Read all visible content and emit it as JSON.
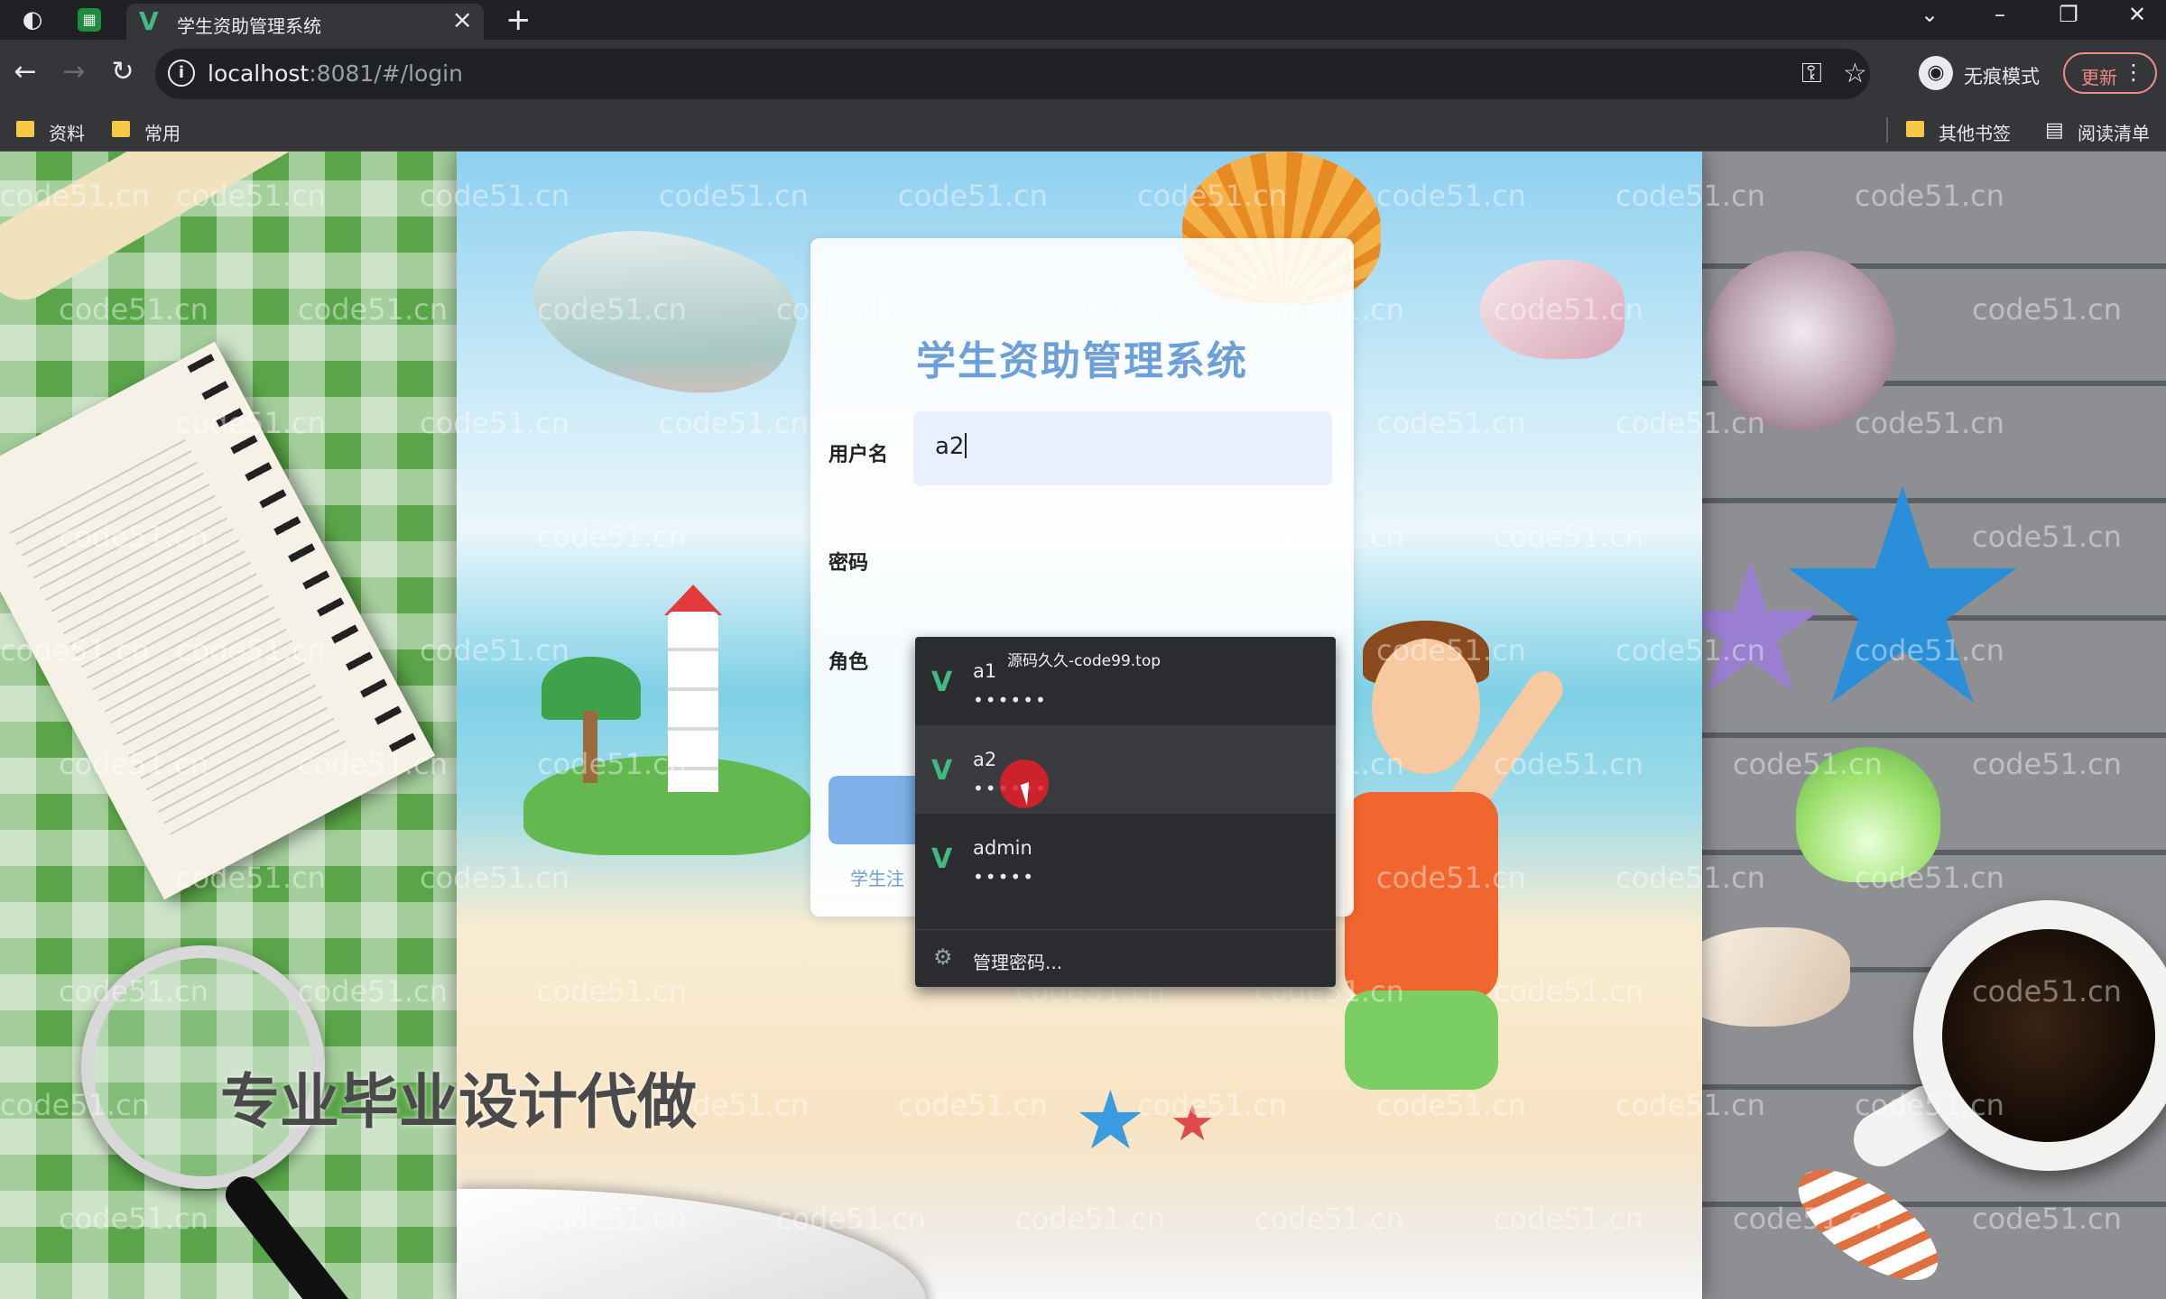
{
  "browser": {
    "tab_title": "学生资助管理系统",
    "url_host": "localhost",
    "url_rest": ":8081/#/login",
    "profile_label": "无痕模式",
    "update_label": "更新",
    "bookmarks": [
      "资料",
      "常用"
    ],
    "other_bookmarks": "其他书签",
    "reading_list": "阅读清单"
  },
  "page": {
    "watermark": "code51.cn",
    "promo_text": "专业毕业设计代做"
  },
  "login": {
    "title": "学生资助管理系统",
    "username_label": "用户名",
    "username_value": "a2",
    "password_label": "密码",
    "role_label": "角色",
    "register_link_partial": "学生注"
  },
  "autofill": {
    "overlay_text": "源码久久-code99.top",
    "items": [
      {
        "user": "a1",
        "password_mask": "••••••"
      },
      {
        "user": "a2",
        "password_mask": "••••••"
      },
      {
        "user": "admin",
        "password_mask": "•••••"
      }
    ],
    "manage_label": "管理密码..."
  },
  "colors": {
    "accent": "#6d9fd8",
    "autofill_bg": "#2b2c2f",
    "vue_green": "#42b883"
  }
}
